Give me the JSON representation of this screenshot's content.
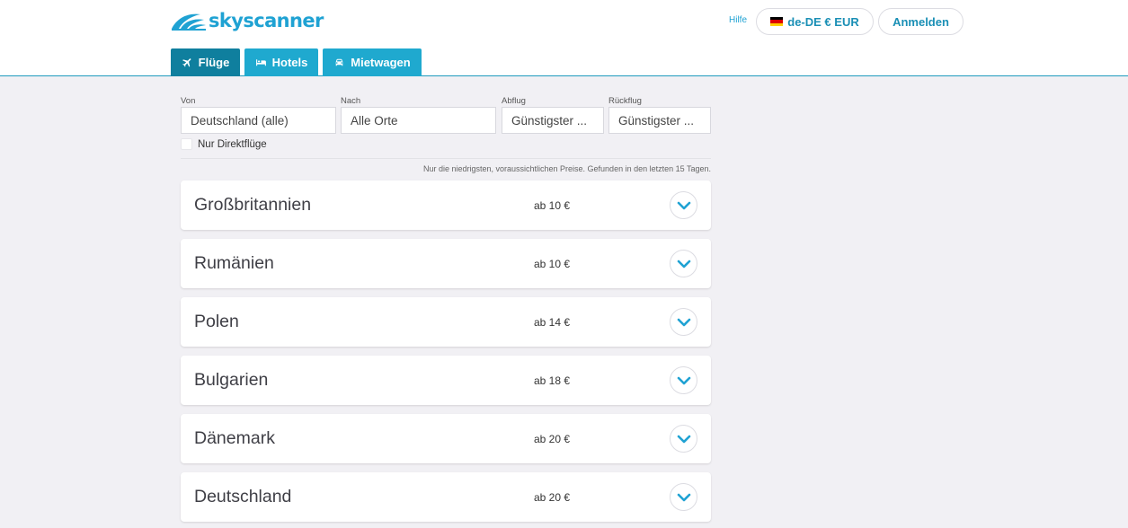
{
  "header": {
    "logo_text": "skyscanner",
    "help_label": "Hilfe",
    "locale_label": "de-DE € EUR",
    "login_label": "Anmelden",
    "brand_color": "#1fa2d3"
  },
  "tabs": [
    {
      "label": "Flüge",
      "icon": "plane-icon",
      "active": true
    },
    {
      "label": "Hotels",
      "icon": "bed-icon",
      "active": false
    },
    {
      "label": "Mietwagen",
      "icon": "car-icon",
      "active": false
    }
  ],
  "search": {
    "from": {
      "label": "Von",
      "value": "Deutschland (alle)"
    },
    "to": {
      "label": "Nach",
      "value": "Alle Orte"
    },
    "depart": {
      "label": "Abflug",
      "value": "Günstigster ..."
    },
    "return": {
      "label": "Rückflug",
      "value": "Günstigster ..."
    },
    "direct_label": "Nur Direktflüge",
    "direct_checked": false
  },
  "note": "Nur die niedrigsten, voraussichtlichen Preise. Gefunden in den letzten 15 Tagen.",
  "results": [
    {
      "name": "Großbritannien",
      "price": "ab 10 €"
    },
    {
      "name": "Rumänien",
      "price": "ab 10 €"
    },
    {
      "name": "Polen",
      "price": "ab 14 €"
    },
    {
      "name": "Bulgarien",
      "price": "ab 18 €"
    },
    {
      "name": "Dänemark",
      "price": "ab 20 €"
    },
    {
      "name": "Deutschland",
      "price": "ab 20 €"
    }
  ]
}
